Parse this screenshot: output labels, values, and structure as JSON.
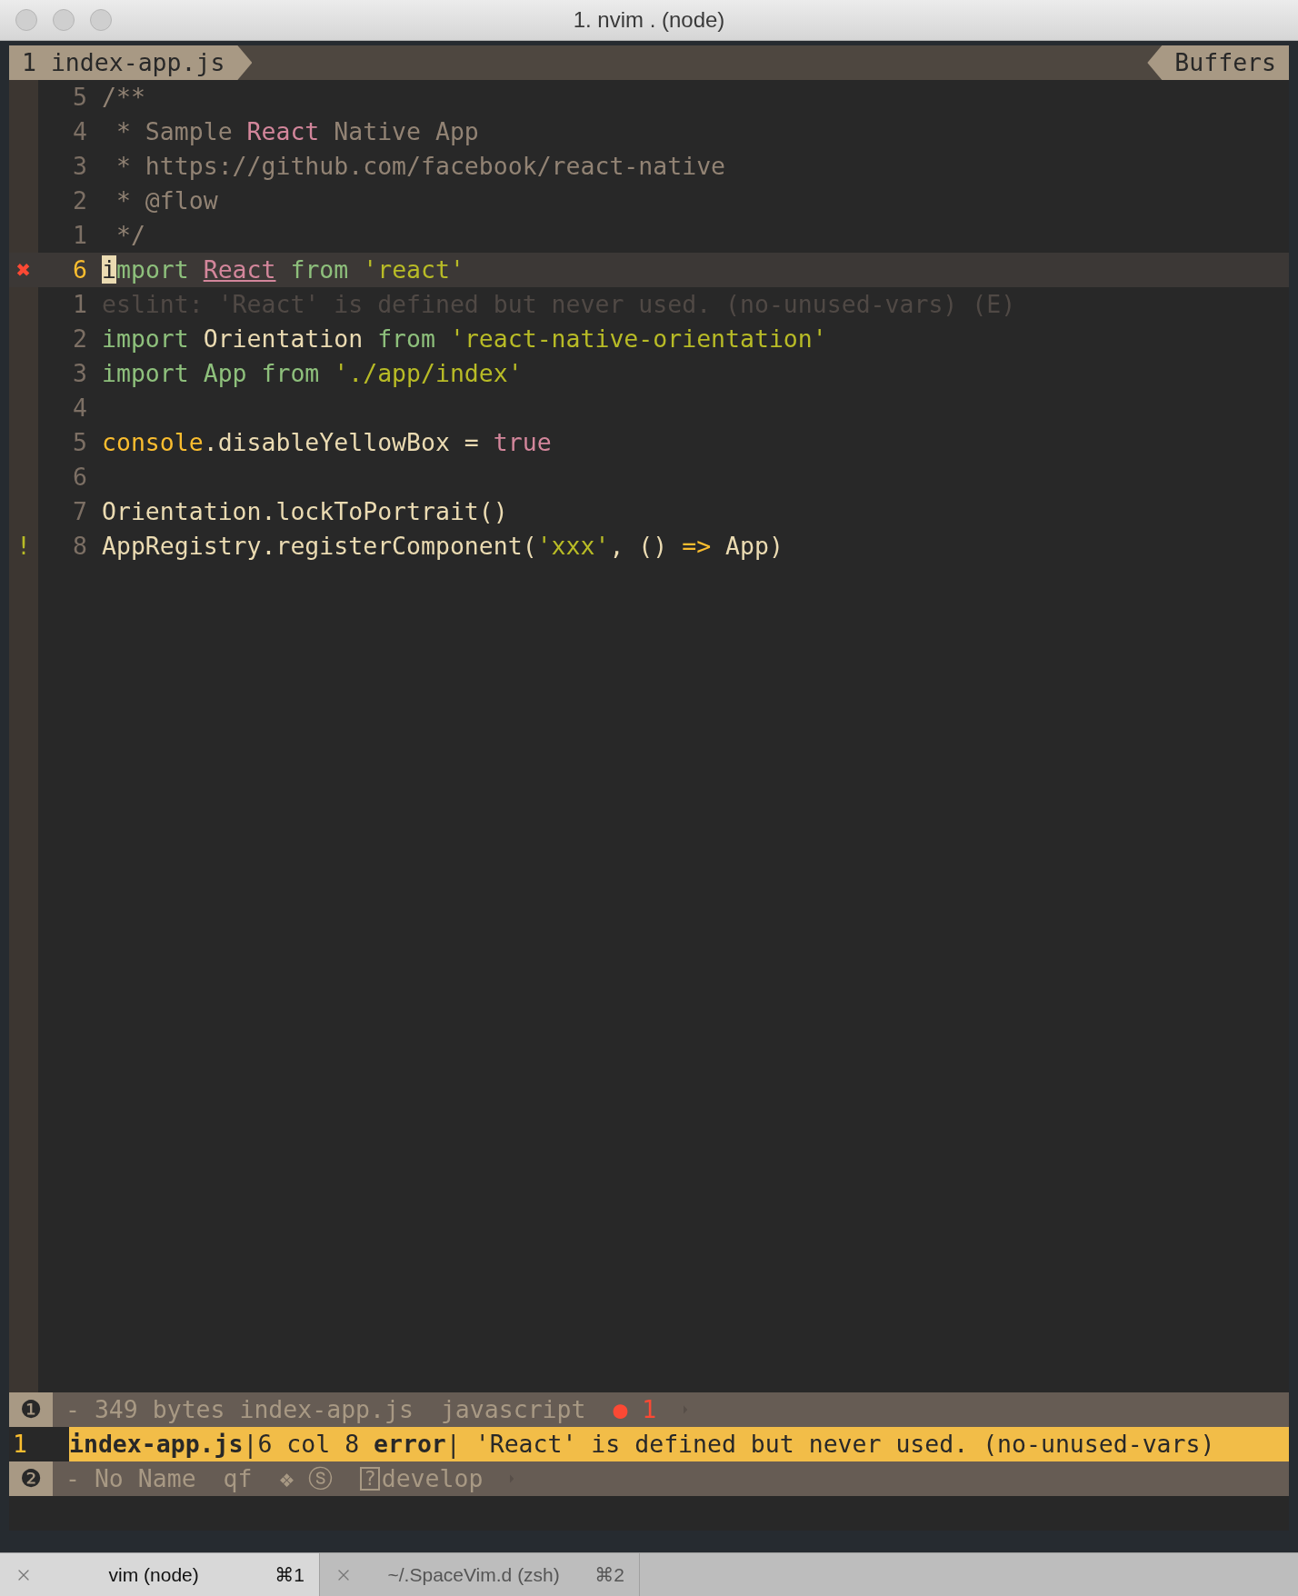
{
  "window": {
    "title": "1. nvim . (node)"
  },
  "tabline": {
    "buffer": {
      "label": "1 index-app.js",
      "selected": true
    },
    "right_label": "Buffers"
  },
  "lines": [
    {
      "number": "5",
      "current": false,
      "tokens": [
        {
          "kind": "comment",
          "text": "/**"
        }
      ]
    },
    {
      "number": "4",
      "current": false,
      "tokens": [
        {
          "kind": "comment",
          "text": " * Sample "
        },
        {
          "kind": "pink",
          "text": "React"
        },
        {
          "kind": "comment",
          "text": " Native App"
        }
      ]
    },
    {
      "number": "3",
      "current": false,
      "tokens": [
        {
          "kind": "comment",
          "text": " * https://github.com/facebook/react-native"
        }
      ]
    },
    {
      "number": "2",
      "current": false,
      "tokens": [
        {
          "kind": "comment",
          "text": " * @flow"
        }
      ]
    },
    {
      "number": "1",
      "current": false,
      "tokens": [
        {
          "kind": "comment",
          "text": " */"
        }
      ]
    },
    {
      "number": "6",
      "current": true,
      "sign": {
        "kind": "error",
        "text": "✖"
      },
      "tokens": [
        {
          "kind": "cursor",
          "text": "i"
        },
        {
          "kind": "keyword",
          "text": "mport "
        },
        {
          "kind": "unused",
          "text": "React"
        },
        {
          "kind": "keyword",
          "text": " from "
        },
        {
          "kind": "string",
          "text": "'react'"
        }
      ]
    },
    {
      "number": "1",
      "current": false,
      "tokens": [
        {
          "kind": "virtual",
          "text": "eslint: 'React' is defined but never used. (no-unused-vars) (E)"
        }
      ]
    },
    {
      "number": "2",
      "current": false,
      "tokens": [
        {
          "kind": "keyword",
          "text": "import "
        },
        {
          "kind": "ident",
          "text": "Orientation"
        },
        {
          "kind": "keyword",
          "text": " from "
        },
        {
          "kind": "string",
          "text": "'react-native-orientation'"
        }
      ]
    },
    {
      "number": "3",
      "current": false,
      "tokens": [
        {
          "kind": "keyword",
          "text": "import App from "
        },
        {
          "kind": "string",
          "text": "'./app/index'"
        }
      ]
    },
    {
      "number": "4",
      "current": false
    },
    {
      "number": "5",
      "current": false,
      "tokens": [
        {
          "kind": "builtin",
          "text": "console"
        },
        {
          "kind": "ident",
          "text": ".disableYellowBox = "
        },
        {
          "kind": "pink",
          "text": "true"
        }
      ]
    },
    {
      "number": "6",
      "current": false
    },
    {
      "number": "7",
      "current": false,
      "tokens": [
        {
          "kind": "ident",
          "text": "Orientation.lockToPortrait()"
        }
      ]
    },
    {
      "number": "8",
      "current": false,
      "sign": {
        "kind": "warning",
        "text": "!"
      },
      "tokens": [
        {
          "kind": "ident",
          "text": "AppRegistry.registerComponent("
        },
        {
          "kind": "string",
          "text": "'xxx'"
        },
        {
          "kind": "ident",
          "text": ", () "
        },
        {
          "kind": "builtin",
          "text": "=>"
        },
        {
          "kind": "ident",
          "text": " App)"
        }
      ]
    }
  ],
  "statusline_1": {
    "badge": "❶",
    "segments": [
      {
        "kind": "plain",
        "text": "- 349 bytes index-app.js"
      },
      {
        "kind": "plain",
        "text": "javascript"
      },
      {
        "kind": "error",
        "text": "● 1"
      }
    ]
  },
  "quickfix": {
    "number": "1",
    "text": "**index-app.js**|6 col 8 **error**| 'React' is defined but never used. (no-unused-vars)"
  },
  "statusline_2": {
    "badge": "❷",
    "segments": [
      {
        "kind": "plain",
        "text": "- No Name"
      },
      {
        "kind": "plain",
        "text": "qf"
      },
      {
        "kind": "plain",
        "text": "❖ ⓢ"
      },
      {
        "kind": "branch",
        "icon": "?",
        "text": "develop"
      }
    ]
  },
  "terminal_tabs": [
    {
      "label": "vim (node)",
      "shortcut": "⌘1",
      "selected": true
    },
    {
      "label": "~/.SpaceVim.d (zsh)",
      "shortcut": "⌘2",
      "selected": false
    }
  ]
}
